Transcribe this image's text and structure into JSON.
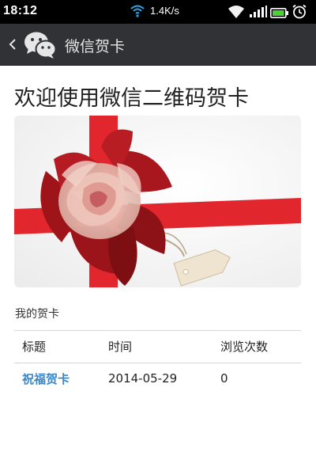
{
  "status_bar": {
    "time": "18:12",
    "network_speed": "1.4K/s",
    "icons": [
      "wifi-activity-icon",
      "wifi-icon",
      "signal-icon",
      "battery-icon",
      "alarm-icon"
    ]
  },
  "title_bar": {
    "back_icon": "chevron-left-icon",
    "logo_icon": "wechat-logo-icon",
    "title": "微信贺卡",
    "background_color": "#303236"
  },
  "main": {
    "heading": "欢迎使用微信二维码贺卡",
    "banner_image": "gift-ribbon-bow-image",
    "section_label": "我的贺卡",
    "table": {
      "columns": [
        "标题",
        "时间",
        "浏览次数"
      ],
      "rows": [
        {
          "title": "祝福贺卡",
          "time": "2014-05-29",
          "views": "0"
        }
      ]
    },
    "link_color": "#3a86c6"
  }
}
